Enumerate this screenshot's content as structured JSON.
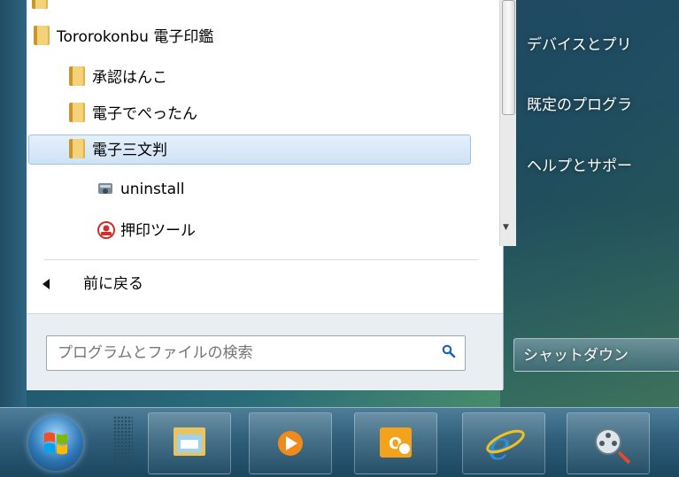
{
  "start_menu": {
    "programs": [
      {
        "label": "Tororokonbu 電子印鑑",
        "icon": "folder-icon"
      },
      {
        "label": "承認はんこ",
        "icon": "folder-icon"
      },
      {
        "label": "電子でぺったん",
        "icon": "folder-icon"
      },
      {
        "label": "電子三文判",
        "icon": "folder-icon",
        "selected": true
      },
      {
        "label": "uninstall",
        "icon": "uninstall-icon"
      },
      {
        "label": "押印ツール",
        "icon": "stamp-tool-icon"
      }
    ],
    "back_label": "前に戻る",
    "search_placeholder": "プログラムとファイルの検索",
    "right_items": [
      "デバイスとプリ",
      "既定のプログラ",
      "ヘルプとサポー"
    ],
    "shutdown_label": "シャットダウン"
  },
  "taskbar": {
    "items": [
      "start-orb",
      "explorer-icon",
      "media-player-icon",
      "outlook-icon",
      "internet-explorer-icon",
      "media-center-icon"
    ]
  },
  "colors": {
    "selection": "#cfe2f6",
    "taskbar": "#2f5f7a"
  }
}
